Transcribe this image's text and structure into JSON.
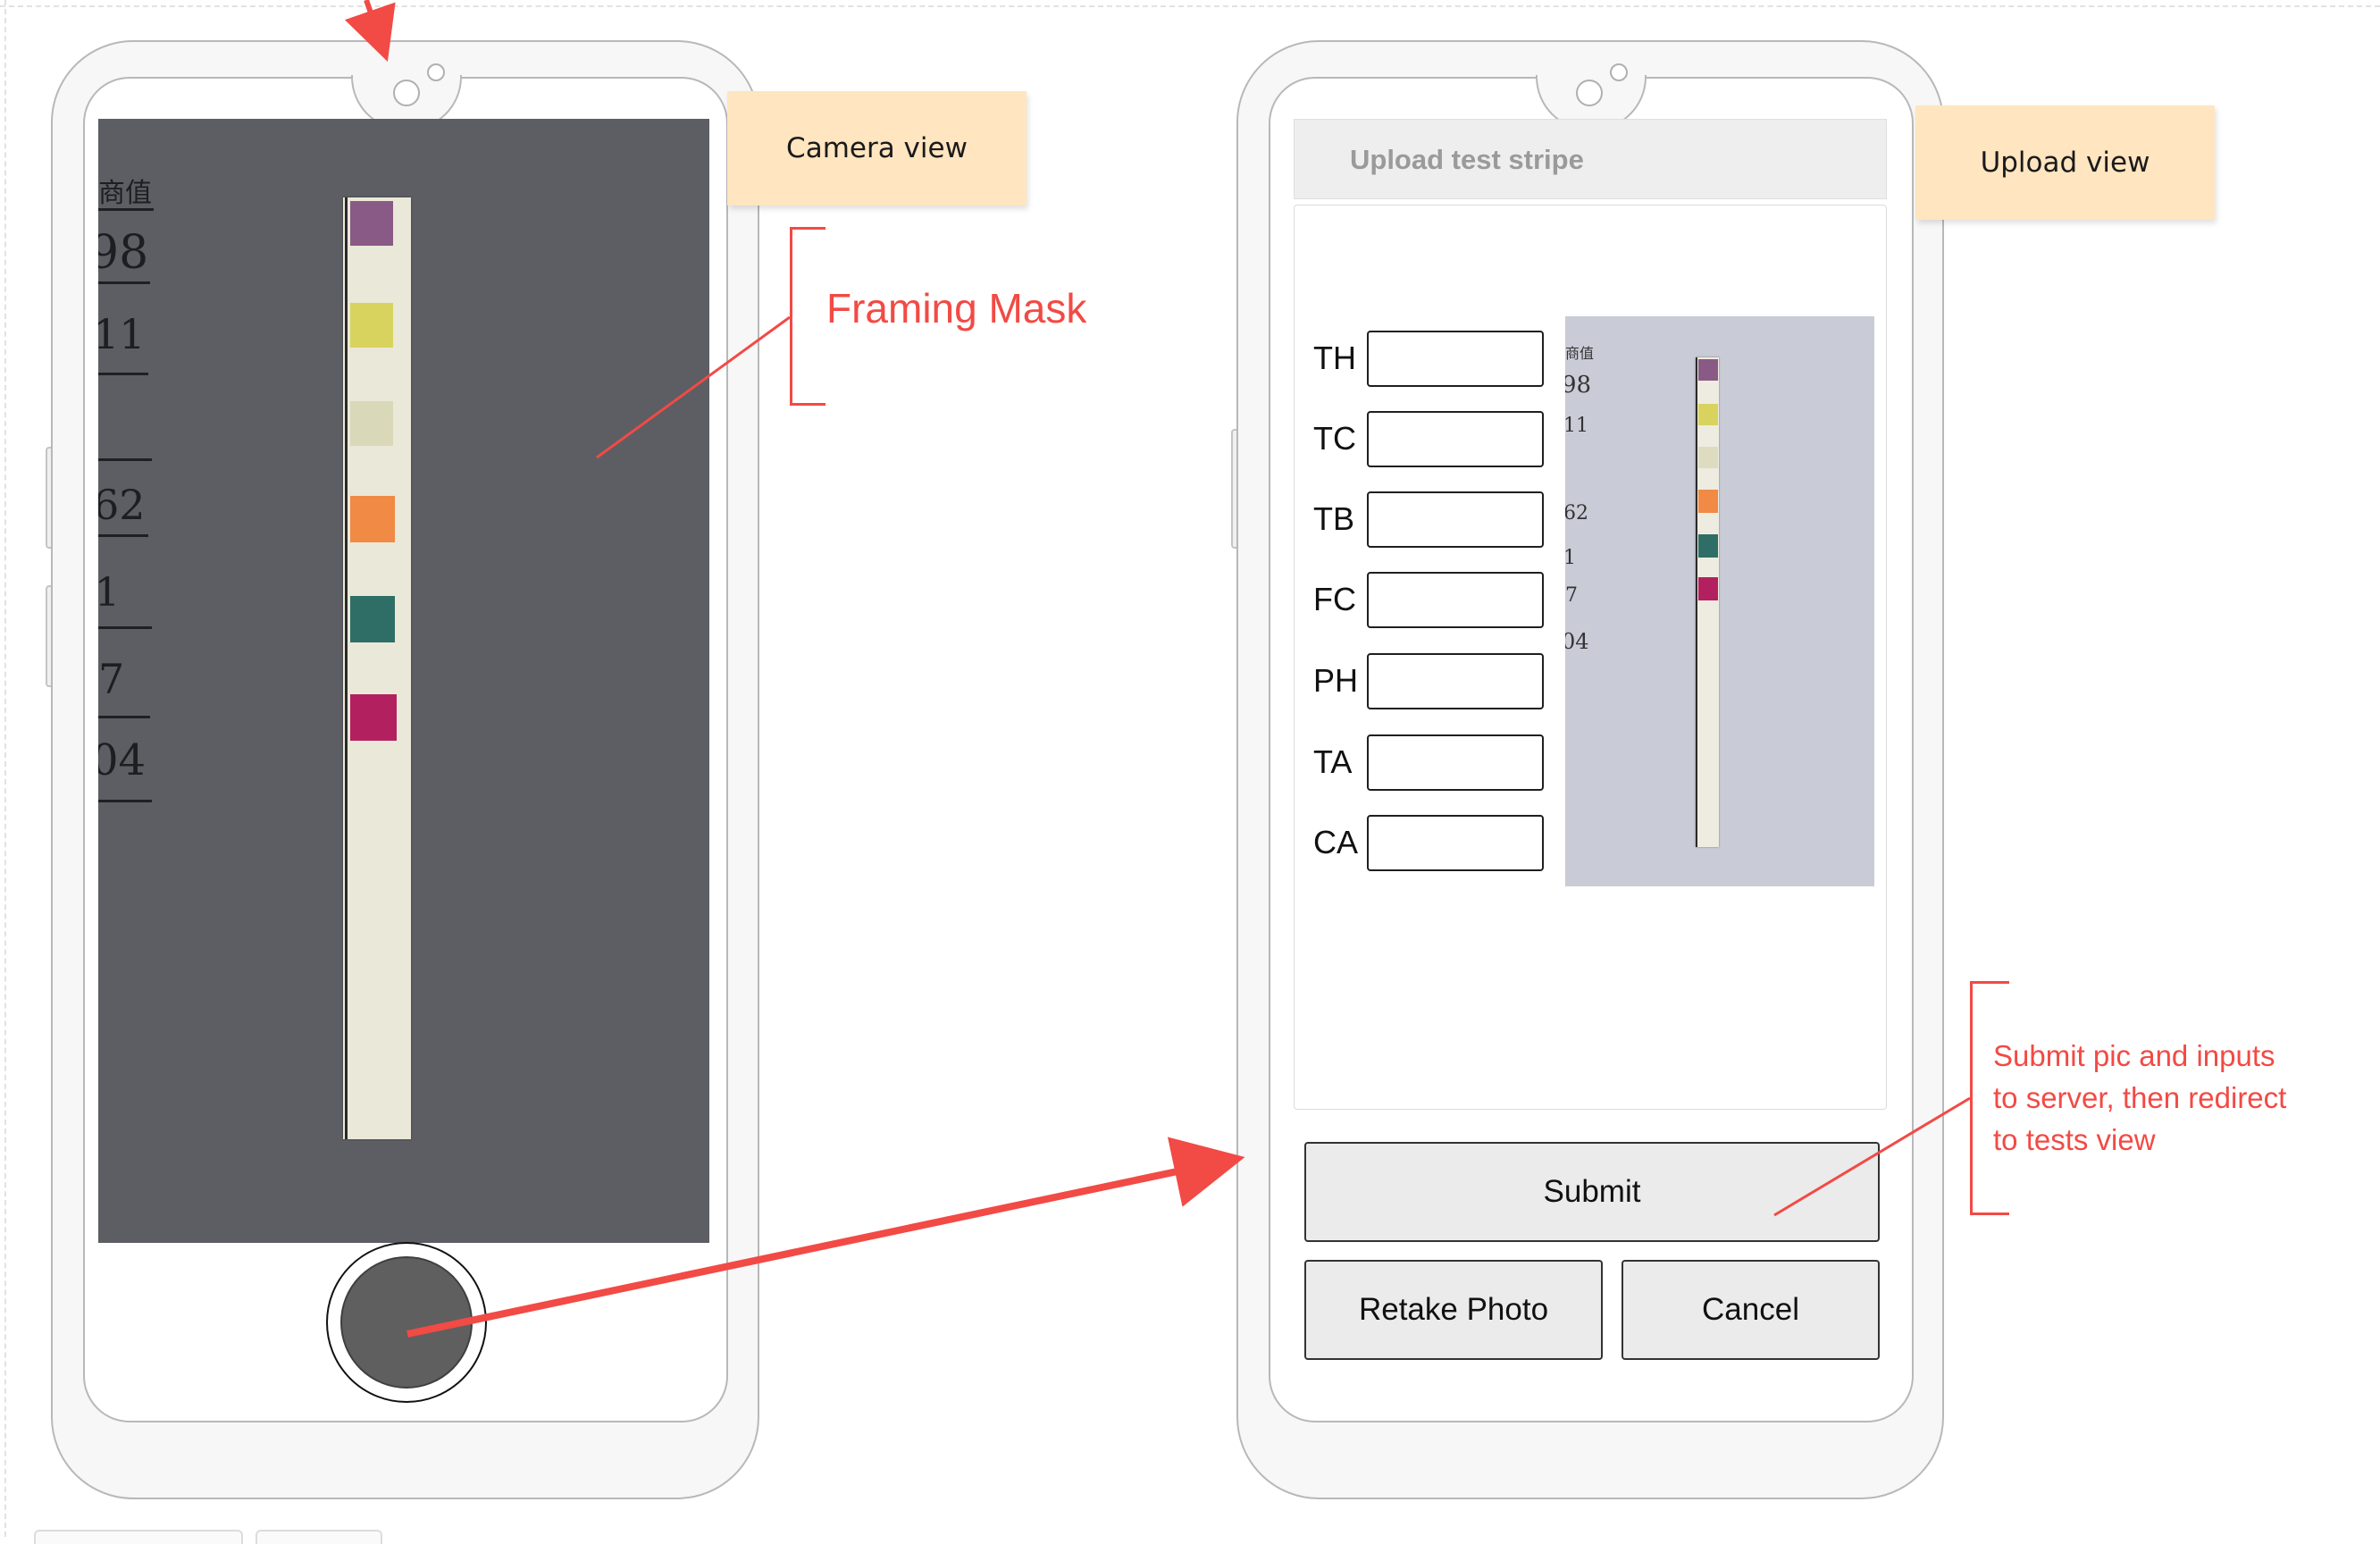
{
  "notes": {
    "camera_view": "Camera view",
    "upload_view": "Upload view"
  },
  "annotations": {
    "framing_mask": "Framing Mask",
    "submit_note_lines": [
      "Submit pic and inputs",
      "to server, then redirect",
      "to tests view"
    ]
  },
  "camera": {
    "handwritten_marks": [
      "商值",
      "98",
      "11",
      "62",
      "1",
      "7",
      "04"
    ]
  },
  "upload": {
    "header": "Upload test stripe",
    "fields": [
      {
        "label": "TH",
        "value": ""
      },
      {
        "label": "TC",
        "value": ""
      },
      {
        "label": "TB",
        "value": ""
      },
      {
        "label": "FC",
        "value": ""
      },
      {
        "label": "PH",
        "value": ""
      },
      {
        "label": "TA",
        "value": ""
      },
      {
        "label": "CA",
        "value": ""
      }
    ],
    "submit_label": "Submit",
    "retake_label": "Retake Photo",
    "cancel_label": "Cancel"
  },
  "colors": {
    "annotation_red": "#f24a45",
    "sticky_note": "#ffe5c0",
    "camera_feed": "#5d5e63",
    "pad_purple": "#8a5a86",
    "pad_yellow": "#d8d35e",
    "pad_pale": "#d9d8b8",
    "pad_orange": "#f08a45",
    "pad_teal": "#2f6e67",
    "pad_magenta": "#b3205f"
  }
}
